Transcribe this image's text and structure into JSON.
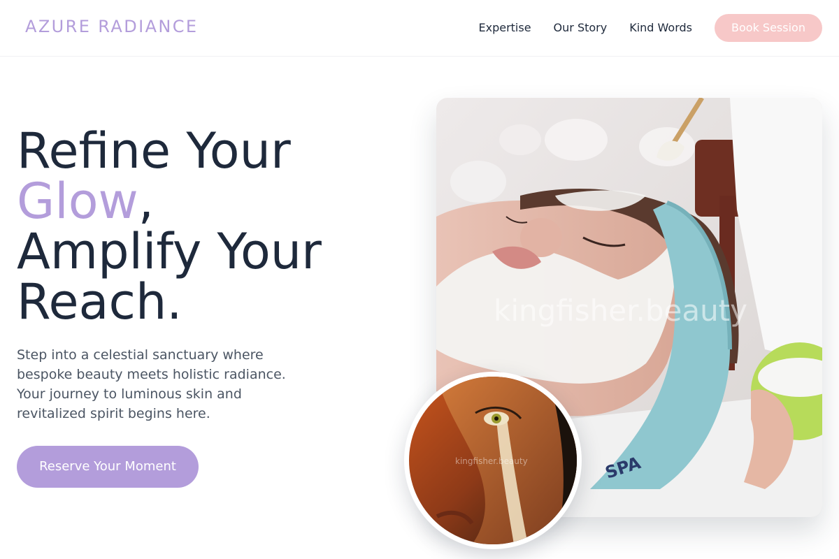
{
  "header": {
    "brand": "AZURE RADIANCE",
    "nav": [
      {
        "label": "Expertise"
      },
      {
        "label": "Our Story"
      },
      {
        "label": "Kind Words"
      }
    ],
    "book_label": "Book Session"
  },
  "hero": {
    "title_line1": "Refine Your",
    "title_accent": "Glow",
    "title_comma": ",",
    "title_line3": "Amplify Your",
    "title_line4": "Reach.",
    "body": "Step into a celestial sanctuary where bespoke beauty meets holistic radiance. Your journey to luminous skin and revitalized spirit begins here.",
    "cta_label": "Reserve Your Moment"
  },
  "images": {
    "main_watermark": "kingfisher.beauty",
    "circle_watermark": "kingfisher.beauty"
  },
  "colors": {
    "accent": "#b39ddb",
    "book_button": "#f7c8c8",
    "heading": "#1e293b",
    "body_text": "#4b5563"
  }
}
